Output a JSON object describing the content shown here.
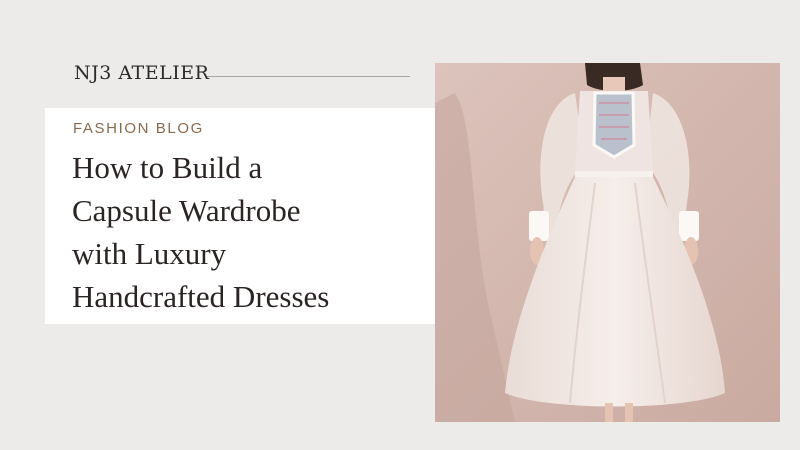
{
  "brand": {
    "name": "NJ3 ATELIER"
  },
  "post": {
    "category": "FASHION BLOG",
    "title_lines": [
      "How to Build a",
      "Capsule Wardrobe",
      "with Luxury",
      "Handcrafted Dresses"
    ]
  },
  "hero_image": {
    "subject": "model in white organza midi dress with long sheer sleeves and embroidered bib bodice"
  },
  "colors": {
    "background": "#ecebea",
    "card": "#ffffff",
    "accent_text": "#8a6a4e",
    "photo_backdrop": "#d3b7af"
  }
}
